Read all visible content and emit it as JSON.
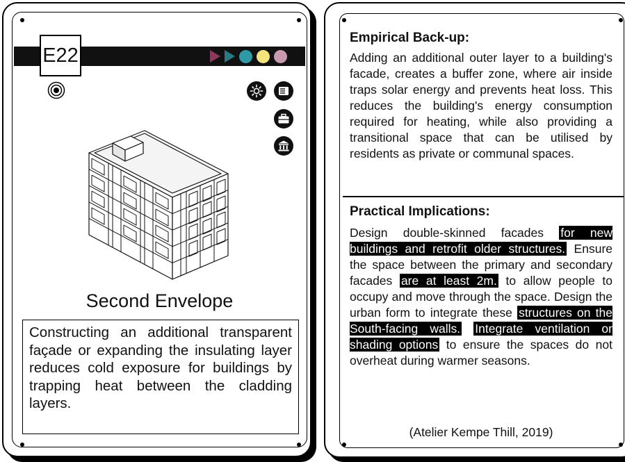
{
  "card_front": {
    "code": "E22",
    "title": "Second Envelope",
    "description": "Constructing an additional transparent façade or expanding the insulating layer reduces cold exposure for buildings by trapping heat between the cladding layers.",
    "markers": [
      {
        "shape": "triangle",
        "color": "#8a3a5a"
      },
      {
        "shape": "triangle",
        "color": "#2a7a86"
      },
      {
        "shape": "circle",
        "color": "#2e9aa6"
      },
      {
        "shape": "circle",
        "color": "#f4e37a"
      },
      {
        "shape": "circle",
        "color": "#c89ab0"
      }
    ],
    "icons": [
      "sun-gear-icon",
      "list-icon",
      "briefcase-icon",
      "government-building-icon",
      "target-icon"
    ]
  },
  "card_back": {
    "empirical_title": "Empirical Back-up:",
    "empirical_text": "Adding an additional outer layer to a building's facade, creates a buffer zone, where air inside traps solar energy and prevents heat loss. This reduces the building's energy consumption required for heating, while also providing a transitional space that can be utilised by residents as private or communal spaces.",
    "practical_title": "Practical Implications:",
    "practical": {
      "p1": "Design double-skinned facades ",
      "h1": "for new buildings and retrofit older structures.",
      "p2": " Ensure the space between the primary and secondary facades ",
      "h2": "are at least 2m.",
      "p3": " to allow people to occupy and move through the space. Design the urban form to integrate these ",
      "h3": "structures on the South-facing walls.",
      "p4": " ",
      "h4": "Integrate ventilation or shading options",
      "p5": " to ensure the spaces do not overheat during warmer seasons."
    },
    "citation": "(Atelier Kempe Thill, 2019)"
  }
}
